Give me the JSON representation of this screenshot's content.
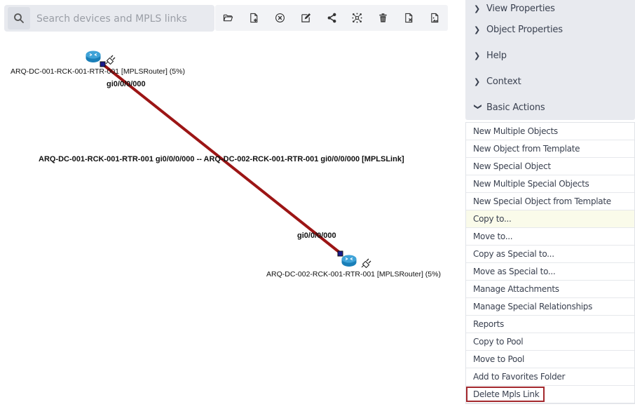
{
  "search": {
    "placeholder": "Search devices and MPLS links",
    "value": "",
    "icon": "search-icon"
  },
  "toolbar": {
    "buttons": [
      {
        "name": "open-button",
        "icon": "folder-open-icon"
      },
      {
        "name": "add-file-button",
        "icon": "file-plus-icon"
      },
      {
        "name": "clear-button",
        "icon": "circle-x-icon"
      },
      {
        "name": "edit-button",
        "icon": "edit-square-icon"
      },
      {
        "name": "share-button",
        "icon": "share-icon"
      },
      {
        "name": "topology-button",
        "icon": "network-hub-icon"
      },
      {
        "name": "delete-button",
        "icon": "trash-icon"
      },
      {
        "name": "remove-file-button",
        "icon": "file-x-icon"
      },
      {
        "name": "export-image-button",
        "icon": "file-image-icon"
      }
    ]
  },
  "canvas": {
    "nodes": [
      {
        "label": "ARQ-DC-001-RCK-001-RTR-001 [MPLSRouter] (5%)",
        "port": "gi0/0/0/000",
        "icon": "router-icon"
      },
      {
        "label": "ARQ-DC-002-RCK-001-RTR-001 [MPLSRouter] (5%)",
        "port": "gi0/0/0/000",
        "icon": "router-icon"
      }
    ],
    "link": {
      "label": "ARQ-DC-001-RCK-001-RTR-001 gi0/0/0/000 -- ARQ-DC-002-RCK-001-RTR-001 gi0/0/0/000 [MPLSLink]",
      "color": "#9c1515"
    }
  },
  "panel": {
    "sections": [
      {
        "label": "View Properties",
        "expanded": false
      },
      {
        "label": "Object Properties",
        "expanded": false
      },
      {
        "label": "Help",
        "expanded": false
      },
      {
        "label": "Context",
        "expanded": false
      },
      {
        "label": "Basic Actions",
        "expanded": true
      }
    ],
    "actions": [
      {
        "label": "New Multiple Objects"
      },
      {
        "label": "New Object from Template"
      },
      {
        "label": "New Special Object"
      },
      {
        "label": "New Multiple Special Objects"
      },
      {
        "label": "New Special Object from Template"
      },
      {
        "label": "Copy to...",
        "state": "hover"
      },
      {
        "label": "Move to..."
      },
      {
        "label": "Copy as Special to..."
      },
      {
        "label": "Move as Special to..."
      },
      {
        "label": "Manage Attachments"
      },
      {
        "label": "Manage Special Relationships"
      },
      {
        "label": "Reports"
      },
      {
        "label": "Copy to Pool"
      },
      {
        "label": "Move to Pool"
      },
      {
        "label": "Add to Favorites Folder"
      },
      {
        "label": "Delete Mpls Link",
        "state": "highlighted"
      }
    ],
    "highlight_color": "#a3282d",
    "hover_color": "#fafbea"
  }
}
